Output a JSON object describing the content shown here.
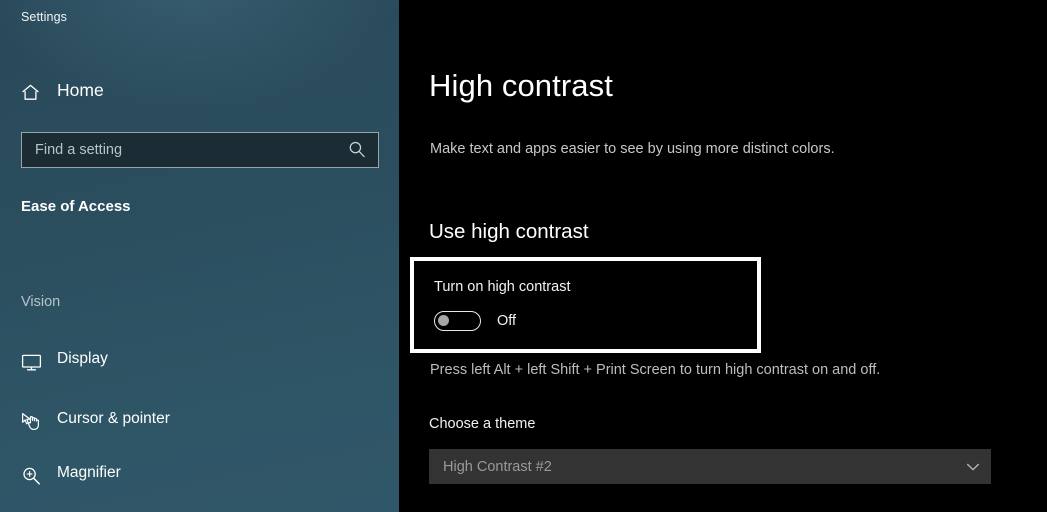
{
  "window": {
    "app_title": "Settings"
  },
  "sidebar": {
    "home": {
      "label": "Home",
      "icon": "home-icon"
    },
    "search": {
      "placeholder": "Find a setting",
      "value": "",
      "icon": "search-icon"
    },
    "app_name": "Ease of Access",
    "groups": [
      {
        "label": "Vision",
        "items": [
          {
            "label": "Display",
            "icon": "monitor-icon"
          },
          {
            "label": "Cursor & pointer",
            "icon": "cursor-pointer-icon"
          },
          {
            "label": "Magnifier",
            "icon": "magnifier-icon"
          }
        ]
      }
    ]
  },
  "main": {
    "title": "High contrast",
    "subtitle": "Make text and apps easier to see by using more distinct colors.",
    "section": {
      "heading": "Use high contrast",
      "toggle": {
        "caption": "Turn on high contrast",
        "state_label": "Off",
        "checked": false
      },
      "hint": "Press left Alt + left Shift + Print Screen to turn high contrast on and off."
    },
    "theme": {
      "label": "Choose a theme",
      "selected": "High Contrast #2",
      "chevron_icon": "chevron-down-icon"
    }
  },
  "colors": {
    "sidebar_top": "#29495a",
    "sidebar_bottom": "#305769",
    "content_bg": "#000000",
    "focus_border": "#ffffff",
    "combo_bg": "#333333",
    "text_primary": "#ffffff",
    "text_secondary": "#c8c8c8"
  }
}
